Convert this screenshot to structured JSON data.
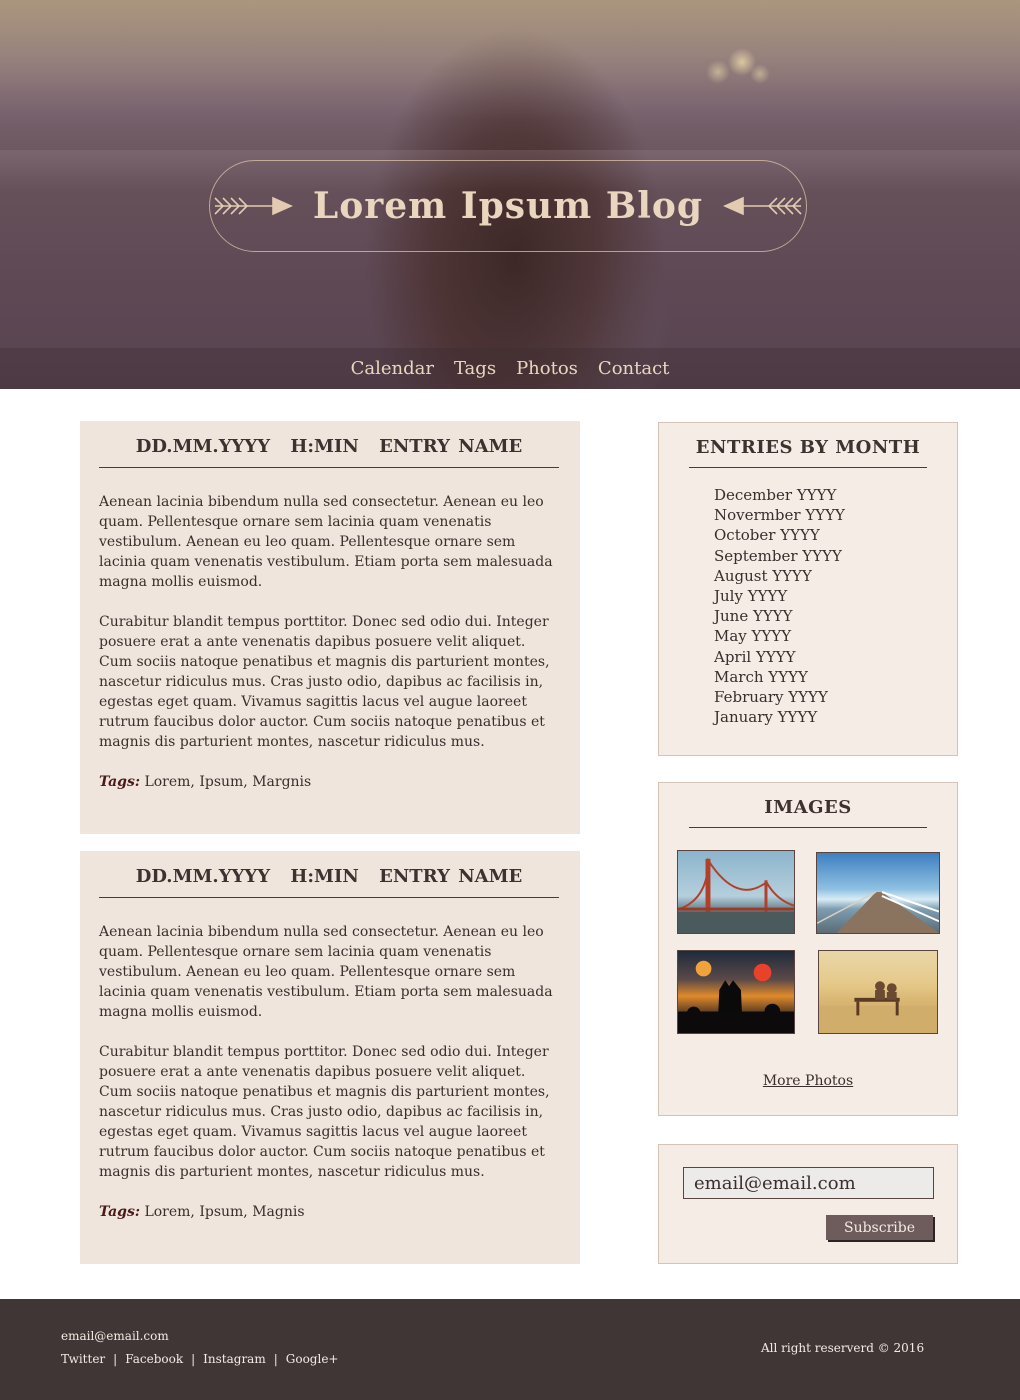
{
  "header": {
    "title": "Lorem Ipsum Blog",
    "left_icon": "arrow-right-icon",
    "right_icon": "arrow-left-icon"
  },
  "nav": {
    "items": [
      {
        "label": "Calendar"
      },
      {
        "label": "Tags"
      },
      {
        "label": "Photos"
      },
      {
        "label": "Contact"
      }
    ]
  },
  "posts": [
    {
      "date": "DD.MM.YYYY",
      "time": "H:MIN",
      "name": "ENTRY NAME",
      "paragraph1": "Aenean lacinia bibendum nulla sed consectetur. Aenean eu leo quam. Pellentesque ornare sem lacinia quam venenatis vestibulum. Aenean eu leo quam. Pellentesque ornare sem lacinia quam venenatis vestibulum. Etiam porta sem malesuada magna mollis euismod.",
      "paragraph2": "Curabitur blandit tempus porttitor. Donec sed odio dui. Integer posuere erat a ante venenatis dapibus posuere velit aliquet. Cum sociis natoque penatibus et magnis dis parturient montes, nascetur ridiculus mus. Cras justo odio, dapibus ac facilisis in, egestas eget quam. Vivamus sagittis lacus vel augue laoreet rutrum faucibus dolor auctor. Cum sociis natoque penatibus et magnis dis parturient montes, nascetur ridiculus mus.",
      "tags_label": "Tags:",
      "tags": "Lorem, Ipsum, Margnis"
    },
    {
      "date": "DD.MM.YYYY",
      "time": "H:MIN",
      "name": "ENTRY NAME",
      "paragraph1": "Aenean lacinia bibendum nulla sed consectetur. Aenean eu leo quam. Pellentesque ornare sem lacinia quam venenatis vestibulum. Aenean eu leo quam. Pellentesque ornare sem lacinia quam venenatis vestibulum. Etiam porta sem malesuada magna mollis euismod.",
      "paragraph2": "Curabitur blandit tempus porttitor. Donec sed odio dui. Integer posuere erat a ante venenatis dapibus posuere velit aliquet. Cum sociis natoque penatibus et magnis dis parturient montes, nascetur ridiculus mus. Cras justo odio, dapibus ac facilisis in, egestas eget quam. Vivamus sagittis lacus vel augue laoreet rutrum faucibus dolor auctor. Cum sociis natoque penatibus et magnis dis parturient montes, nascetur ridiculus mus.",
      "tags_label": "Tags:",
      "tags": "Lorem, Ipsum, Magnis"
    }
  ],
  "sidebar": {
    "months": {
      "title": "ENTRIES BY MONTH",
      "items": [
        "December YYYY",
        "Novermber YYYY",
        "October YYYY",
        "September YYYY",
        "August YYYY",
        "July YYYY",
        "June YYYY",
        "May YYYY",
        "April YYYY",
        "March YYYY",
        "February YYYY",
        "January YYYY"
      ]
    },
    "images": {
      "title": "IMAGES",
      "more_label": "More Photos"
    },
    "subscribe": {
      "email_value": "email@email.com",
      "button_label": "Subscribe"
    }
  },
  "footer": {
    "email": "email@email.com",
    "social": [
      "Twitter",
      "Facebook",
      "Instagram",
      "Google+"
    ],
    "separator": "|",
    "copyright": "All right reserverd © 2016"
  },
  "colors": {
    "post_bg": "#efe5dd",
    "widget_bg": "#f5ece6",
    "footer_bg": "#413636",
    "button_bg": "#6e5b5b",
    "title_color": "#ead6bf"
  }
}
